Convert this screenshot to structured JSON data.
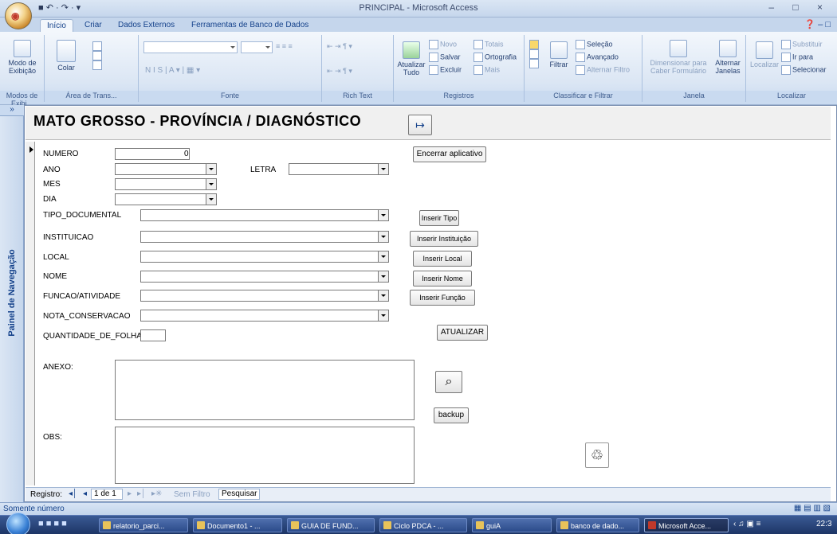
{
  "window": {
    "title": "PRINCIPAL - Microsoft Access",
    "quick_access": "■ ↶ · ↷ · ▾",
    "controls": "– □ ×",
    "office_button": "◉"
  },
  "tabs": [
    "Início",
    "Criar",
    "Dados Externos",
    "Ferramentas de Banco de Dados"
  ],
  "help": "❓ – □",
  "ribbon": {
    "groups": {
      "modos": "Modos de Exibi...",
      "area": "Área de Trans...",
      "fonte": "Fonte",
      "rich": "Rich Text",
      "registros": "Registros",
      "classificar": "Classificar e Filtrar",
      "janela": "Janela",
      "localizar": "Localizar"
    },
    "modo_exibicao": "Modo de Exibição",
    "colar": "Colar",
    "font_buttons": "N  I  S  |  A ▾  |  ▦ ▾",
    "align_buttons": "≡ ≡ ≡",
    "list_buttons": "⇤ ⇥  ¶ ▾",
    "atualizar": "Atualizar Tudo",
    "novo": "Novo",
    "salvar": "Salvar",
    "excluir": "Excluir",
    "totais": "Totais",
    "ortografia": "Ortografia",
    "mais": "Mais",
    "filtrar": "Filtrar",
    "selecao": "Seleção",
    "avancado": "Avançado",
    "alternar_filtro": "Alternar Filtro",
    "dimensionar": "Dimensionar para Caber Formulário",
    "alternar_janelas": "Alternar Janelas",
    "localizar": "Localizar",
    "substituir": "Substituir",
    "ir_para": "Ir para",
    "selecionar": "Selecionar"
  },
  "nav_pane": {
    "label": "Painel de Navegação",
    "toggle": "»"
  },
  "form": {
    "title": "MATO GROSSO - PROVÍNCIA / DIAGNÓSTICO",
    "exit_icon": "↦",
    "exit_label": "Encerrar aplicativo",
    "fields": {
      "numero": "NUMERO",
      "numero_value": "0",
      "ano": "ANO",
      "letra": "LETRA",
      "mes": "MES",
      "dia": "DIA",
      "tipo_documental": "TIPO_DOCUMENTAL",
      "instituicao": "INSTITUICAO",
      "local": "LOCAL",
      "nome": "NOME",
      "funcao": "FUNCAO/ATIVIDADE",
      "nota": "NOTA_CONSERVACAO",
      "quantidade": "QUANTIDADE_DE_FOLHA",
      "anexo": "ANEXO:",
      "obs": "OBS:"
    },
    "buttons": {
      "inserir_tipo": "Inserir Tipo",
      "inserir_instituicao": "Inserir Instituição",
      "inserir_local": "Inserir Local",
      "inserir_nome": "Inserir Nome",
      "inserir_funcao": "Inserir Função",
      "atualizar": "ATUALIZAR",
      "search": "⌕",
      "backup": "backup",
      "trash": "♲"
    }
  },
  "record_nav": {
    "label": "Registro:",
    "first": "◂│",
    "prev": "◂",
    "position": "1 de 1",
    "next": "▸",
    "last": "▸│",
    "new": "▸✳",
    "filter": "Sem Filtro",
    "search": "Pesquisar"
  },
  "status": {
    "text": "Somente número",
    "views": "▦ ▤ ▥ ▧"
  },
  "taskbar": {
    "items": [
      "relatorio_parci...",
      "Documento1 - ...",
      "GUIA DE FUND...",
      "Ciclo PDCA - ...",
      "guiA",
      "banco de dado...",
      "Microsoft Acce..."
    ],
    "tray": "‹ ♫ ▣ ≡",
    "clock": "22:3"
  }
}
